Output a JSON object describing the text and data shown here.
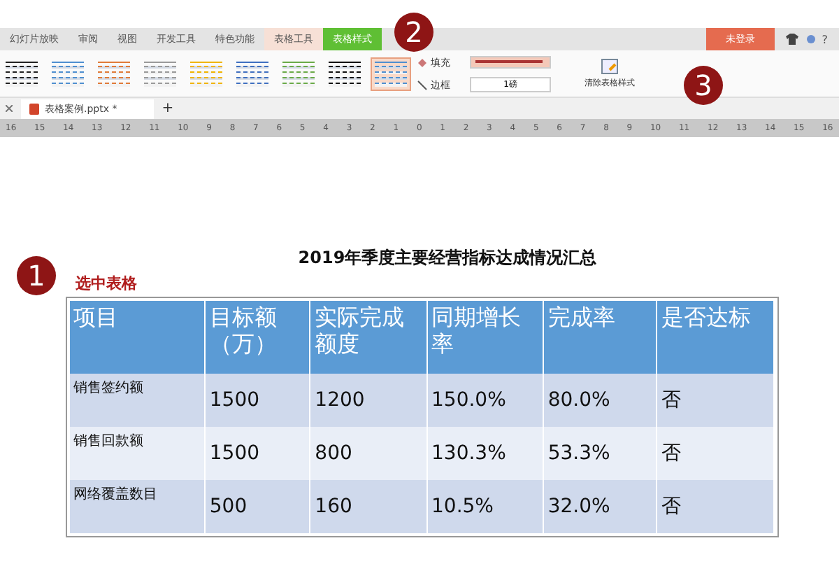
{
  "menu_tabs": [
    {
      "label": "幻灯片放映",
      "selected": false,
      "kind": "plain"
    },
    {
      "label": "审阅",
      "selected": false,
      "kind": "plain"
    },
    {
      "label": "视图",
      "selected": false,
      "kind": "plain"
    },
    {
      "label": "开发工具",
      "selected": false,
      "kind": "plain"
    },
    {
      "label": "特色功能",
      "selected": false,
      "kind": "plain"
    },
    {
      "label": "表格工具",
      "selected": false,
      "kind": "context"
    },
    {
      "label": "表格样式",
      "selected": true,
      "kind": "context"
    }
  ],
  "login_button": "未登录",
  "help_label": "?",
  "table_styles": [
    {
      "color": "#222222",
      "selected": false
    },
    {
      "color": "#4f8fd0",
      "selected": false
    },
    {
      "color": "#e07b39",
      "selected": false
    },
    {
      "color": "#9a9a9a",
      "selected": false
    },
    {
      "color": "#f0b400",
      "selected": false
    },
    {
      "color": "#3f6fc0",
      "selected": false
    },
    {
      "color": "#6aaa48",
      "selected": false
    },
    {
      "color": "#111111",
      "selected": false
    },
    {
      "color": "#4f8fd0",
      "selected": true
    }
  ],
  "fill_label": "填充",
  "border_label": "边框",
  "line_weight": "1磅",
  "clear_style_label": "清除表格样式",
  "doc_tab": "表格案例.pptx *",
  "new_tab_label": "+",
  "ruler_labels": [
    "16",
    "15",
    "14",
    "13",
    "12",
    "11",
    "10",
    "9",
    "8",
    "7",
    "6",
    "5",
    "4",
    "3",
    "2",
    "1",
    "0",
    "1",
    "2",
    "3",
    "4",
    "5",
    "6",
    "7",
    "8",
    "9",
    "10",
    "11",
    "12",
    "13",
    "14",
    "15",
    "16"
  ],
  "steps": [
    {
      "number": "1",
      "caption": "选中表格"
    },
    {
      "number": "2"
    },
    {
      "number": "3"
    }
  ],
  "slide": {
    "title": "2019年季度主要经营指标达成情况汇总",
    "table": {
      "columns": [
        "项目",
        "目标额（万）",
        "实际完成额度",
        "同期增长率",
        "完成率",
        "是否达标"
      ],
      "rows": [
        [
          "销售签约额",
          "1500",
          "1200",
          "150.0%",
          "80.0%",
          "否"
        ],
        [
          "销售回款额",
          "1500",
          "800",
          "130.3%",
          "53.3%",
          "否"
        ],
        [
          "网络覆盖数目",
          "500",
          "160",
          "10.5%",
          "32.0%",
          "否"
        ]
      ]
    }
  }
}
